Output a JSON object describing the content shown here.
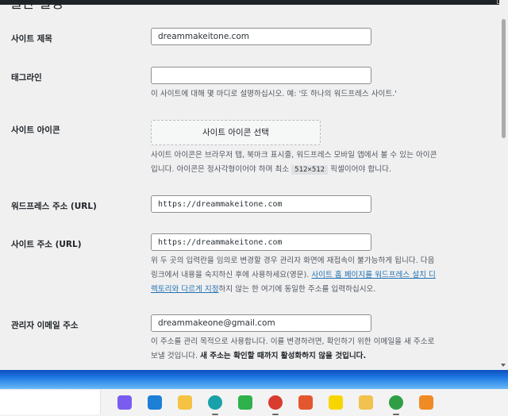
{
  "page": {
    "heading": "일반 설정"
  },
  "fields": {
    "site_title": {
      "label": "사이트 제목",
      "value": "dreammakeitone.com"
    },
    "tagline": {
      "label": "태그라인",
      "value": "",
      "description": "이 사이트에 대해 몇 마디로 설명하십시오. 예: '또 하나의 워드프레스 사이트.'"
    },
    "site_icon": {
      "label": "사이트 아이콘",
      "button": "사이트 아이콘 선택",
      "description_1": "사이트 아이콘은 브라우저 탭, 북마크 표시줄, 워드프레스 모바일 앱에서 볼 수 있는 아이콘",
      "description_2a": "입니다. 아이콘은 정사각형이어야 하며 최소 ",
      "description_code": "512×512",
      "description_2b": " 픽셀이어야 합니다."
    },
    "wp_address": {
      "label": "워드프레스 주소 (URL)",
      "value": "https://dreammakeitone.com"
    },
    "site_address": {
      "label": "사이트 주소 (URL)",
      "value": "https://dreammakeitone.com",
      "desc_1": "위 두 곳의 입력란을 임의로 변경할 경우 관리자 화면에 재접속이 불가능하게 됩니다. 다음",
      "desc_2a": "링크에서 내용을 숙지하신 후에 사용하세요(영문). ",
      "desc_link_1": "사이트 홈 페이지를 워드프레스 설치 디",
      "desc_link_2": "렉토리와 다르게 지정",
      "desc_3": "하지 않는 한 여기에 동일한 주소를 입력하십시오."
    },
    "admin_email": {
      "label": "관리자 이메일 주소",
      "value": "dreammakeone@gmail.com",
      "desc_1": "이 주소를 관리 목적으로 사용합니다. 이를 변경하려면, 확인하기 위한 이메일을 새 주소로",
      "desc_2a": "보낼 것입니다. ",
      "desc_2b": "새 주소는 확인할 때까지 활성화하지 않을 것입니다."
    }
  },
  "taskbar": {
    "icons": [
      {
        "name": "copilot-icon",
        "color": "#7b5cf0"
      },
      {
        "name": "store-icon",
        "color": "#1e7fd6"
      },
      {
        "name": "file-explorer-icon",
        "color": "#f5c242"
      },
      {
        "name": "edge-icon",
        "color": "#1aa0a8"
      },
      {
        "name": "green-app-icon",
        "color": "#2fb24c"
      },
      {
        "name": "chrome-icon",
        "color": "#d93b2f"
      },
      {
        "name": "paint-app-icon",
        "color": "#e4572e"
      },
      {
        "name": "kakaotalk-icon",
        "color": "#f7d600"
      },
      {
        "name": "character-app-icon",
        "color": "#f2c14e"
      },
      {
        "name": "chrome-profile-icon",
        "color": "#2f9e44"
      },
      {
        "name": "orange-app-icon",
        "color": "#f08a24"
      }
    ]
  }
}
